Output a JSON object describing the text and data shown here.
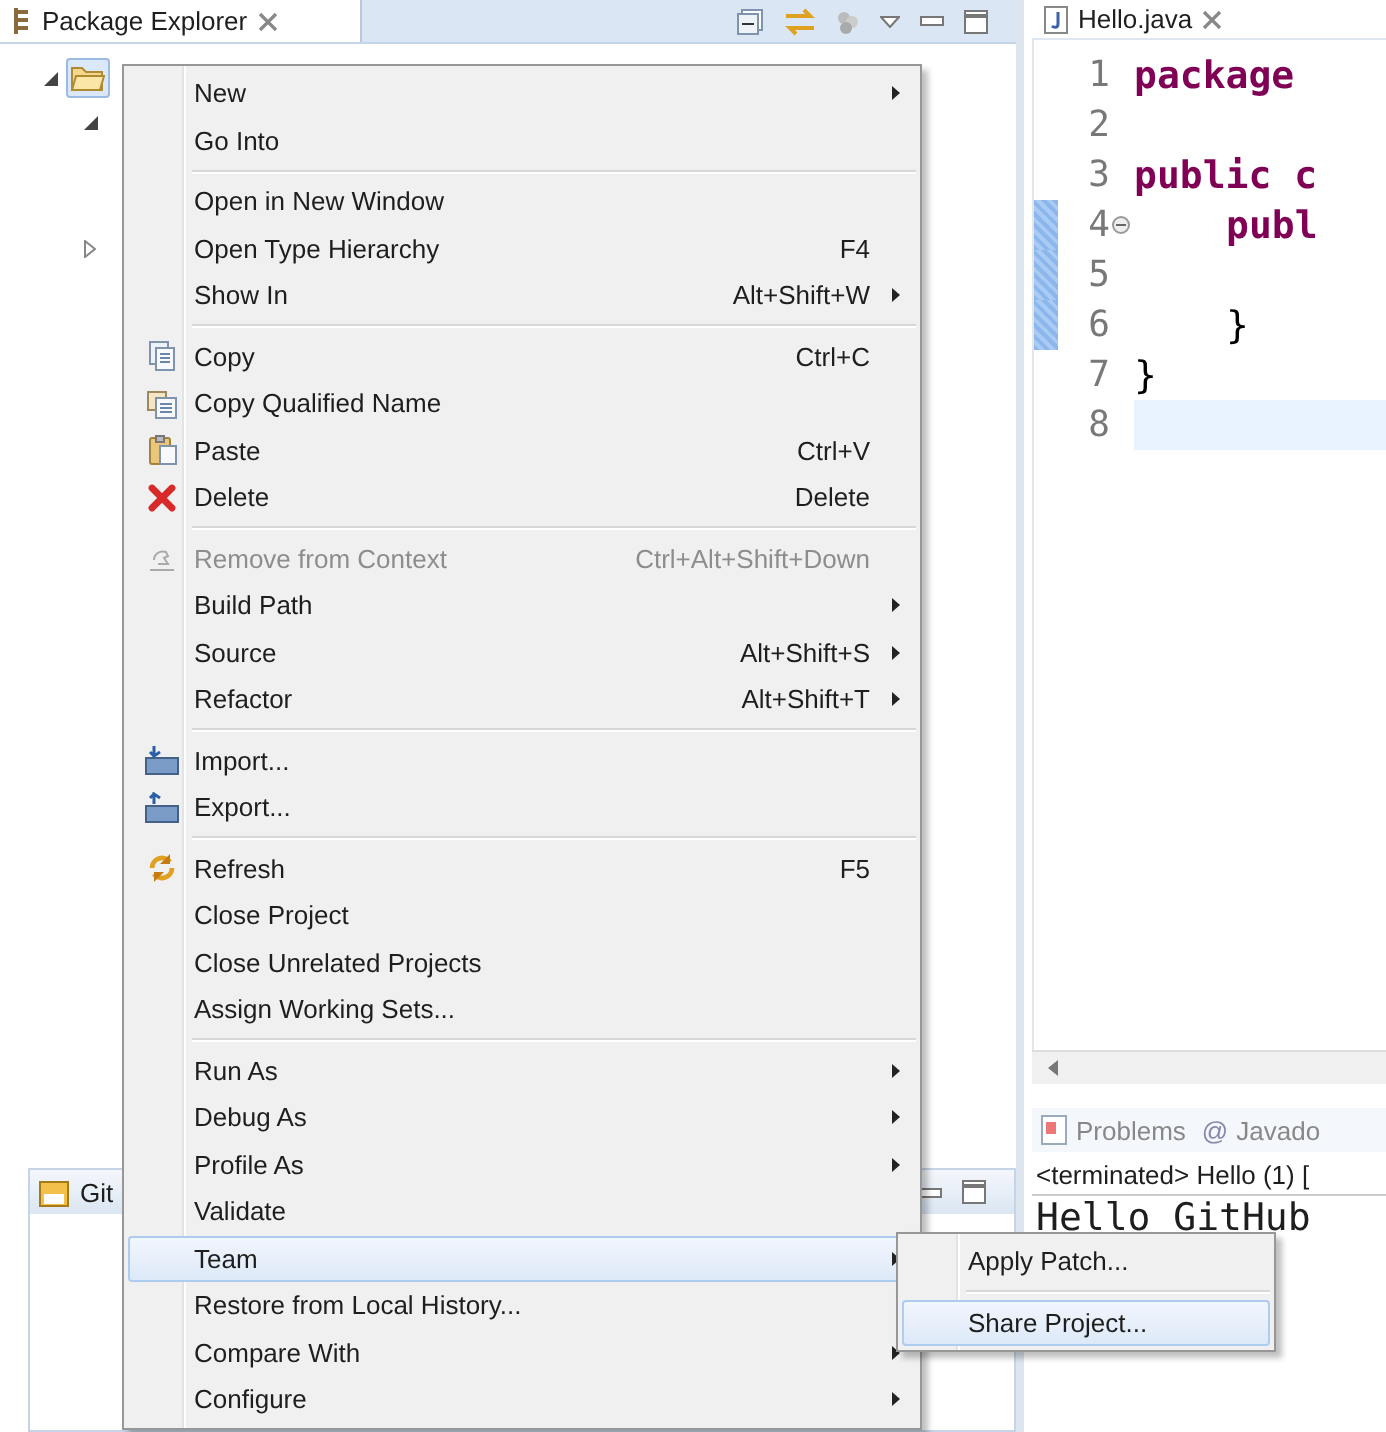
{
  "package_explorer": {
    "title": "Package Explorer",
    "tree": [
      {
        "expanded": true,
        "children": [
          {
            "expanded": true
          },
          {
            "expanded": false
          }
        ]
      }
    ]
  },
  "git_view": {
    "title": "Git"
  },
  "editor": {
    "tab": "Hello.java",
    "lines": [
      {
        "number": "1",
        "code": "package",
        "kind": "keyword",
        "indented": false,
        "foldable": false,
        "changed": false,
        "current": false
      },
      {
        "number": "2",
        "foldable": false,
        "changed": false,
        "current": false
      },
      {
        "number": "3",
        "code": "public c",
        "kind": "keyword",
        "indented": false,
        "foldable": false,
        "changed": false,
        "current": false
      },
      {
        "number": "4",
        "code": "publ",
        "kind": "keyword",
        "indented": true,
        "foldable": true,
        "changed": true,
        "current": false
      },
      {
        "number": "5",
        "foldable": false,
        "changed": true,
        "current": false
      },
      {
        "number": "6",
        "code": "}",
        "kind": "plain",
        "indented": true,
        "foldable": false,
        "changed": true,
        "current": false
      },
      {
        "number": "7",
        "code": "}",
        "kind": "plain",
        "indented": false,
        "foldable": false,
        "changed": false,
        "current": false
      },
      {
        "number": "8",
        "foldable": false,
        "changed": false,
        "current": true
      }
    ]
  },
  "console": {
    "tabs": [
      {
        "label": "Problems"
      },
      {
        "symbol": "@",
        "label": "Javado"
      }
    ],
    "status": "<terminated> Hello (1) [",
    "output": "Hello GitHub"
  },
  "context_menu": {
    "items": [
      {
        "kind": "item",
        "label": "New",
        "submenu": true,
        "selected": false,
        "disabled": false
      },
      {
        "kind": "item",
        "label": "Go Into",
        "selected": false,
        "disabled": false
      },
      {
        "kind": "separator"
      },
      {
        "kind": "item",
        "label": "Open in New Window",
        "selected": false,
        "disabled": false
      },
      {
        "kind": "item",
        "label": "Open Type Hierarchy",
        "shortcut": "F4",
        "selected": false,
        "disabled": false
      },
      {
        "kind": "item",
        "label": "Show In",
        "shortcut": "Alt+Shift+W",
        "submenu": true,
        "selected": false,
        "disabled": false
      },
      {
        "kind": "separator"
      },
      {
        "kind": "item",
        "label": "Copy",
        "shortcut": "Ctrl+C",
        "selected": false,
        "disabled": false
      },
      {
        "kind": "item",
        "label": "Copy Qualified Name",
        "selected": false,
        "disabled": false
      },
      {
        "kind": "item",
        "label": "Paste",
        "shortcut": "Ctrl+V",
        "selected": false,
        "disabled": false
      },
      {
        "kind": "item",
        "label": "Delete",
        "shortcut": "Delete",
        "selected": false,
        "disabled": false
      },
      {
        "kind": "separator"
      },
      {
        "kind": "item",
        "label": "Remove from Context",
        "shortcut": "Ctrl+Alt+Shift+Down",
        "selected": false,
        "disabled": true
      },
      {
        "kind": "item",
        "label": "Build Path",
        "submenu": true,
        "selected": false,
        "disabled": false
      },
      {
        "kind": "item",
        "label": "Source",
        "shortcut": "Alt+Shift+S",
        "submenu": true,
        "selected": false,
        "disabled": false
      },
      {
        "kind": "item",
        "label": "Refactor",
        "shortcut": "Alt+Shift+T",
        "submenu": true,
        "selected": false,
        "disabled": false
      },
      {
        "kind": "separator"
      },
      {
        "kind": "item",
        "label": "Import...",
        "selected": false,
        "disabled": false
      },
      {
        "kind": "item",
        "label": "Export...",
        "selected": false,
        "disabled": false
      },
      {
        "kind": "separator"
      },
      {
        "kind": "item",
        "label": "Refresh",
        "shortcut": "F5",
        "selected": false,
        "disabled": false
      },
      {
        "kind": "item",
        "label": "Close Project",
        "selected": false,
        "disabled": false
      },
      {
        "kind": "item",
        "label": "Close Unrelated Projects",
        "selected": false,
        "disabled": false
      },
      {
        "kind": "item",
        "label": "Assign Working Sets...",
        "selected": false,
        "disabled": false
      },
      {
        "kind": "separator"
      },
      {
        "kind": "item",
        "label": "Run As",
        "submenu": true,
        "selected": false,
        "disabled": false
      },
      {
        "kind": "item",
        "label": "Debug As",
        "submenu": true,
        "selected": false,
        "disabled": false
      },
      {
        "kind": "item",
        "label": "Profile As",
        "submenu": true,
        "selected": false,
        "disabled": false
      },
      {
        "kind": "item",
        "label": "Validate",
        "selected": false,
        "disabled": false
      },
      {
        "kind": "item",
        "label": "Team",
        "submenu": true,
        "selected": true,
        "disabled": false
      },
      {
        "kind": "item",
        "label": "Restore from Local History...",
        "selected": false,
        "disabled": false
      },
      {
        "kind": "item",
        "label": "Compare With",
        "submenu": true,
        "selected": false,
        "disabled": false
      },
      {
        "kind": "item",
        "label": "Configure",
        "submenu": true,
        "selected": false,
        "disabled": false
      }
    ]
  },
  "team_submenu": {
    "items": [
      {
        "kind": "item",
        "label": "Apply Patch...",
        "selected": false
      },
      {
        "kind": "separator"
      },
      {
        "kind": "item",
        "label": "Share Project...",
        "selected": true
      }
    ]
  }
}
